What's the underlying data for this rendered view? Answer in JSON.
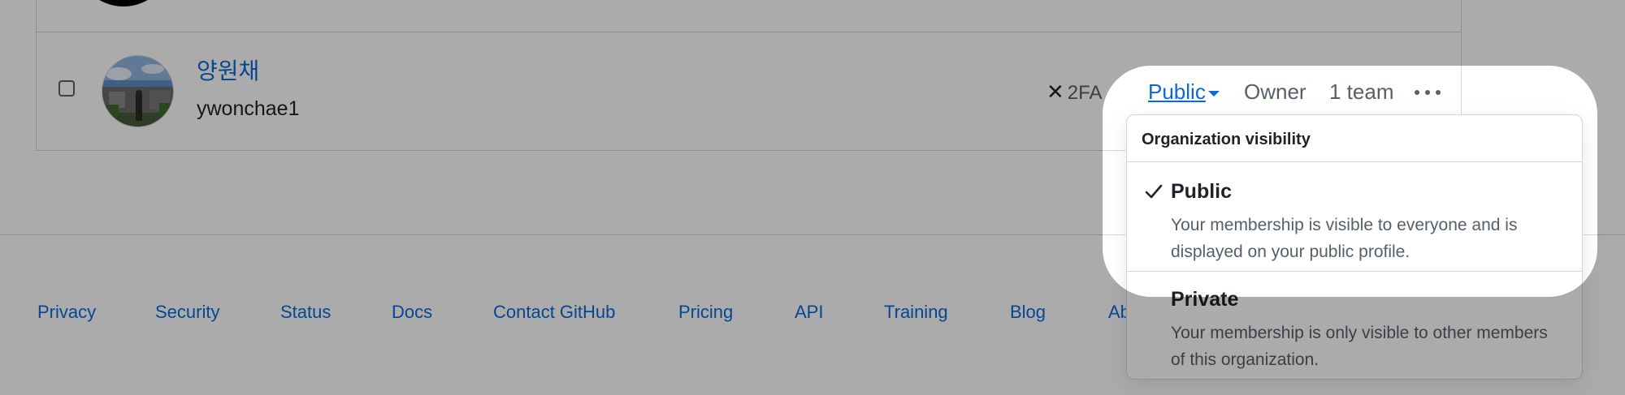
{
  "member": {
    "display_name": "양원채",
    "login": "ywonchae1",
    "twofa_label": "2FA",
    "visibility_label": "Public",
    "role": "Owner",
    "teams": "1 team"
  },
  "visibility_menu": {
    "header": "Organization visibility",
    "items": [
      {
        "title": "Public",
        "description": "Your membership is visible to everyone and is displayed on your public profile.",
        "selected": true
      },
      {
        "title": "Private",
        "description": "Your membership is only visible to other members of this organization.",
        "selected": false
      }
    ]
  },
  "footer": {
    "links": [
      "Privacy",
      "Security",
      "Status",
      "Docs",
      "Contact GitHub",
      "Pricing",
      "API",
      "Training",
      "Blog",
      "Ab"
    ]
  },
  "colors": {
    "link": "#0969da",
    "muted": "#57606a",
    "border": "#d0d7de",
    "overlay": "rgba(0,0,0,0.33)"
  },
  "icons": {
    "twofa_status": "x-icon",
    "selected": "check-icon",
    "more": "kebab-horizontal-icon",
    "dropdown": "caret-down-icon"
  }
}
